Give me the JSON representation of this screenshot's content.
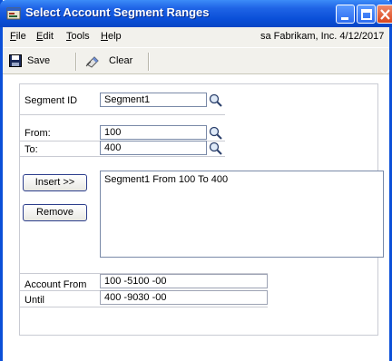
{
  "window": {
    "title": "Select Account Segment Ranges"
  },
  "menu": {
    "items": [
      "File",
      "Edit",
      "Tools",
      "Help"
    ],
    "company": "sa  Fabrikam, Inc.  4/12/2017"
  },
  "toolbar": {
    "save_label": "Save",
    "clear_label": "Clear"
  },
  "form": {
    "segment_id_label": "Segment ID",
    "segment_id_value": "Segment1",
    "from_label": "From:",
    "from_value": "100",
    "to_label": "To:",
    "to_value": "400",
    "insert_label": "Insert >>",
    "remove_label": "Remove",
    "ranges_text": "Segment1 From 100 To 400",
    "account_from_label": "Account From",
    "account_from_value": "100 -5100 -00",
    "until_label": "Until",
    "until_value": "400 -9030 -00"
  },
  "colors": {
    "title_bar": "#0a4fd8",
    "close_button": "#d8461e"
  },
  "icons": {
    "window": "window-icon",
    "minimize": "minimize-icon",
    "maximize": "maximize-icon",
    "close": "close-icon",
    "save": "floppy-disk-icon",
    "clear": "eraser-icon",
    "lookup": "magnifier-icon"
  }
}
